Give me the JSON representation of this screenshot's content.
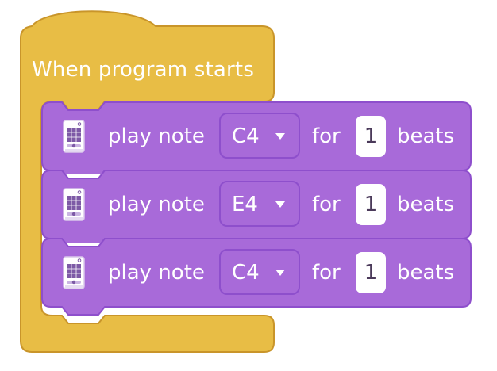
{
  "hat_block": {
    "label": "When program starts",
    "color": "#e8bd45",
    "border_color": "#c9952a"
  },
  "command_blocks": [
    {
      "icon": "device-icon",
      "play_label": "play note",
      "note": "C4",
      "for_label": "for",
      "beats": "1",
      "beats_label": "beats"
    },
    {
      "icon": "device-icon",
      "play_label": "play note",
      "note": "E4",
      "for_label": "for",
      "beats": "1",
      "beats_label": "beats"
    },
    {
      "icon": "device-icon",
      "play_label": "play note",
      "note": "C4",
      "for_label": "for",
      "beats": "1",
      "beats_label": "beats"
    }
  ],
  "colors": {
    "command_fill": "#a86ad9",
    "command_border": "#8e4fcc",
    "text": "#ffffff"
  }
}
